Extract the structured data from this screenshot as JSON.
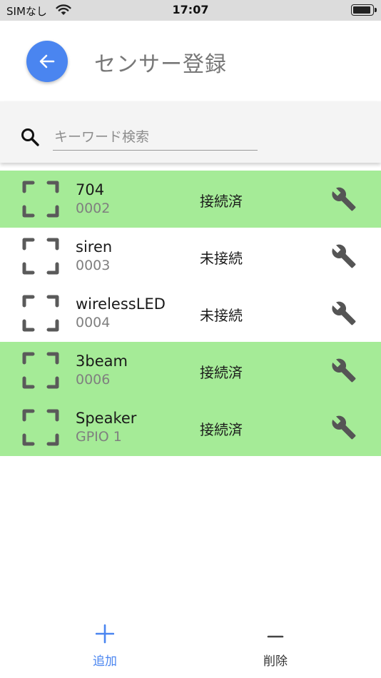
{
  "status_bar": {
    "carrier": "SIMなし",
    "time": "17:07",
    "wifi_icon": "wifi-icon",
    "battery_icon": "battery-icon"
  },
  "header": {
    "title": "センサー登録",
    "back_icon": "arrow-left-icon",
    "back_color": "#4a85f0"
  },
  "search": {
    "placeholder": "キーワード検索",
    "value": "",
    "icon": "search-icon"
  },
  "colors": {
    "connected_row": "#a5eb97",
    "disconnected_row": "#ffffff",
    "accent": "#4a85f0"
  },
  "sensors": [
    {
      "name": "704",
      "id": "0002",
      "status": "接続済",
      "connected": true
    },
    {
      "name": "siren",
      "id": "0003",
      "status": "未接続",
      "connected": false
    },
    {
      "name": "wirelessLED",
      "id": "0004",
      "status": "未接続",
      "connected": false
    },
    {
      "name": "3beam",
      "id": "0006",
      "status": "接続済",
      "connected": true
    },
    {
      "name": "Speaker",
      "id": "GPIO 1",
      "status": "接続済",
      "connected": true
    }
  ],
  "bottom_bar": {
    "add_label": "追加",
    "delete_label": "削除",
    "add_icon": "plus-icon",
    "delete_icon": "minus-icon"
  }
}
